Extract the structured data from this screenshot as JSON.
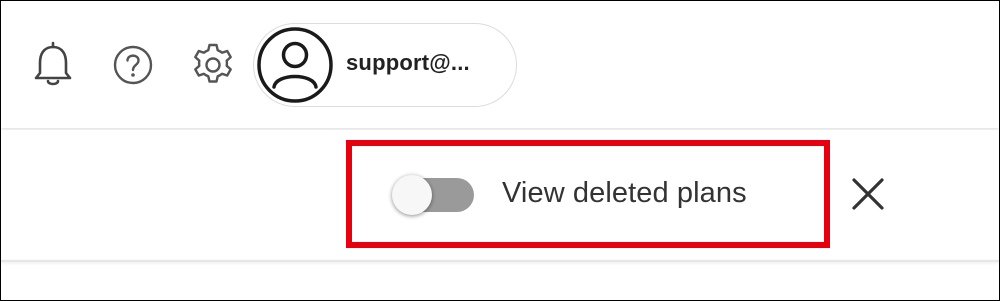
{
  "header": {
    "icons": [
      "bell-icon",
      "help-icon",
      "gear-icon"
    ],
    "account": {
      "name": "support@...",
      "avatar_icon": "user-avatar-icon"
    }
  },
  "deleted_plans": {
    "toggle_label": "View deleted plans",
    "toggle_on": false,
    "close_icon": "close-icon"
  },
  "colors": {
    "highlight": "#e8000e",
    "toggle_track": "#9a9a9a",
    "text": "#333333"
  }
}
